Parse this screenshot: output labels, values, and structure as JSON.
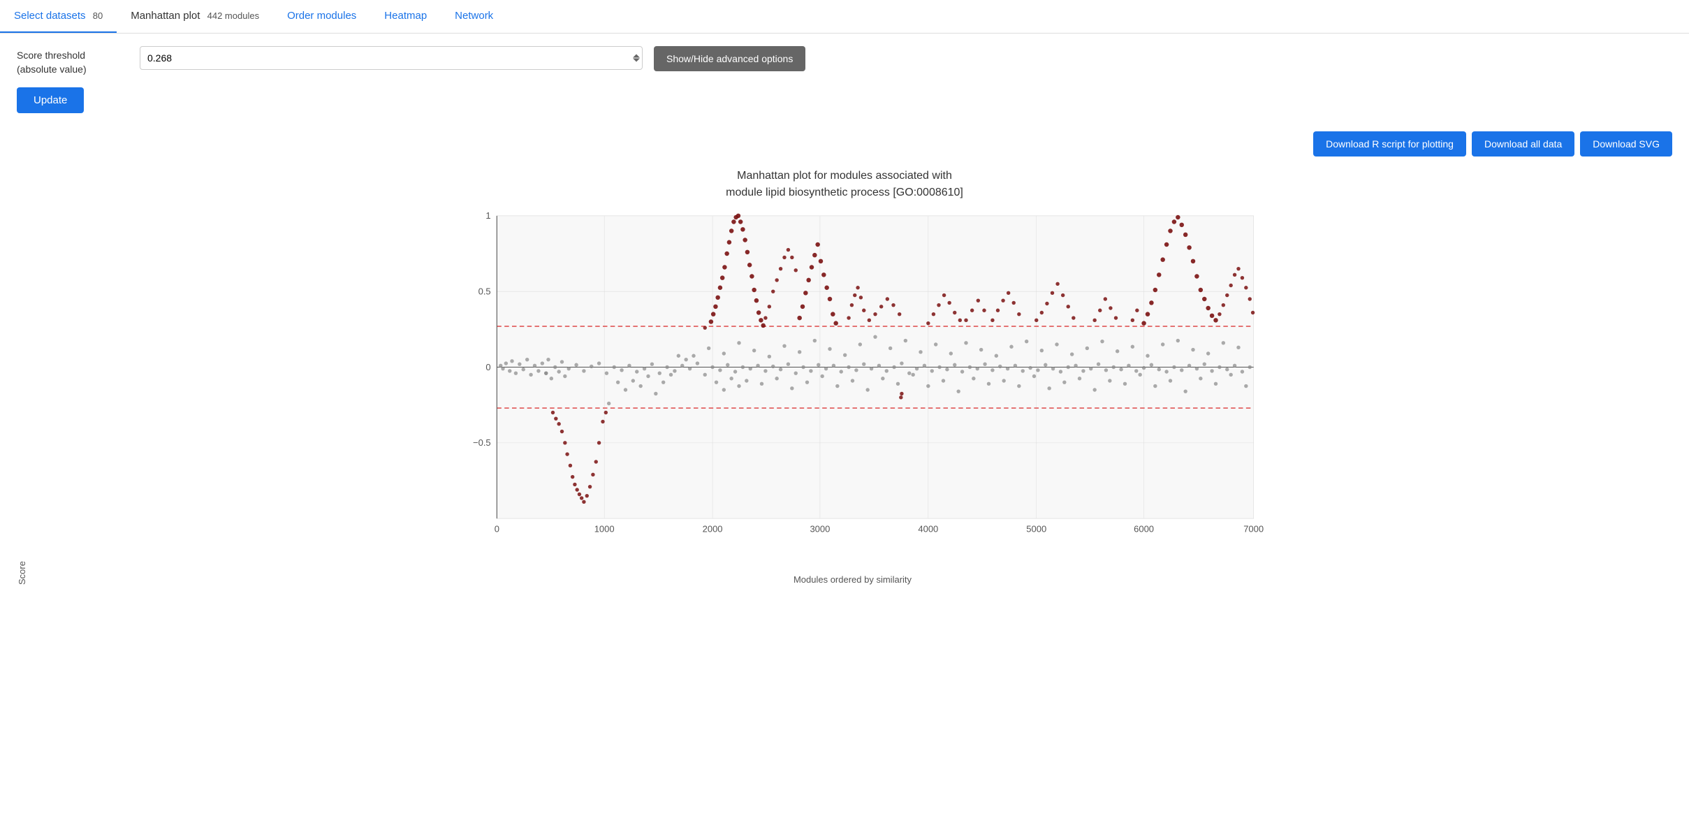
{
  "tabs": [
    {
      "id": "select-datasets",
      "label": "Select datasets",
      "count": "80",
      "active": false
    },
    {
      "id": "manhattan-plot",
      "label": "Manhattan plot",
      "count": "442 modules",
      "active": true
    },
    {
      "id": "order-modules",
      "label": "Order modules",
      "count": "",
      "active": false
    },
    {
      "id": "heatmap",
      "label": "Heatmap",
      "count": "",
      "active": false
    },
    {
      "id": "network",
      "label": "Network",
      "count": "",
      "active": false
    }
  ],
  "controls": {
    "score_label_line1": "Score threshold",
    "score_label_line2": "(absolute value)",
    "score_value": "0.268",
    "show_hide_label": "Show/Hide advanced options",
    "update_label": "Update"
  },
  "downloads": {
    "r_script": "Download R script for plotting",
    "all_data": "Download all data",
    "svg": "Download SVG"
  },
  "chart": {
    "title_line1": "Manhattan plot for modules associated with",
    "title_line2": "module lipid biosynthetic process [GO:0008610]",
    "y_axis_label": "Score",
    "x_axis_label": "Modules ordered by similarity",
    "x_ticks": [
      "0",
      "1000",
      "2000",
      "3000",
      "4000",
      "5000",
      "6000",
      "7000"
    ],
    "y_ticks": [
      "1",
      "0.5",
      "0",
      "-0.5"
    ],
    "threshold_pos": 0.268,
    "threshold_neg": -0.268
  }
}
